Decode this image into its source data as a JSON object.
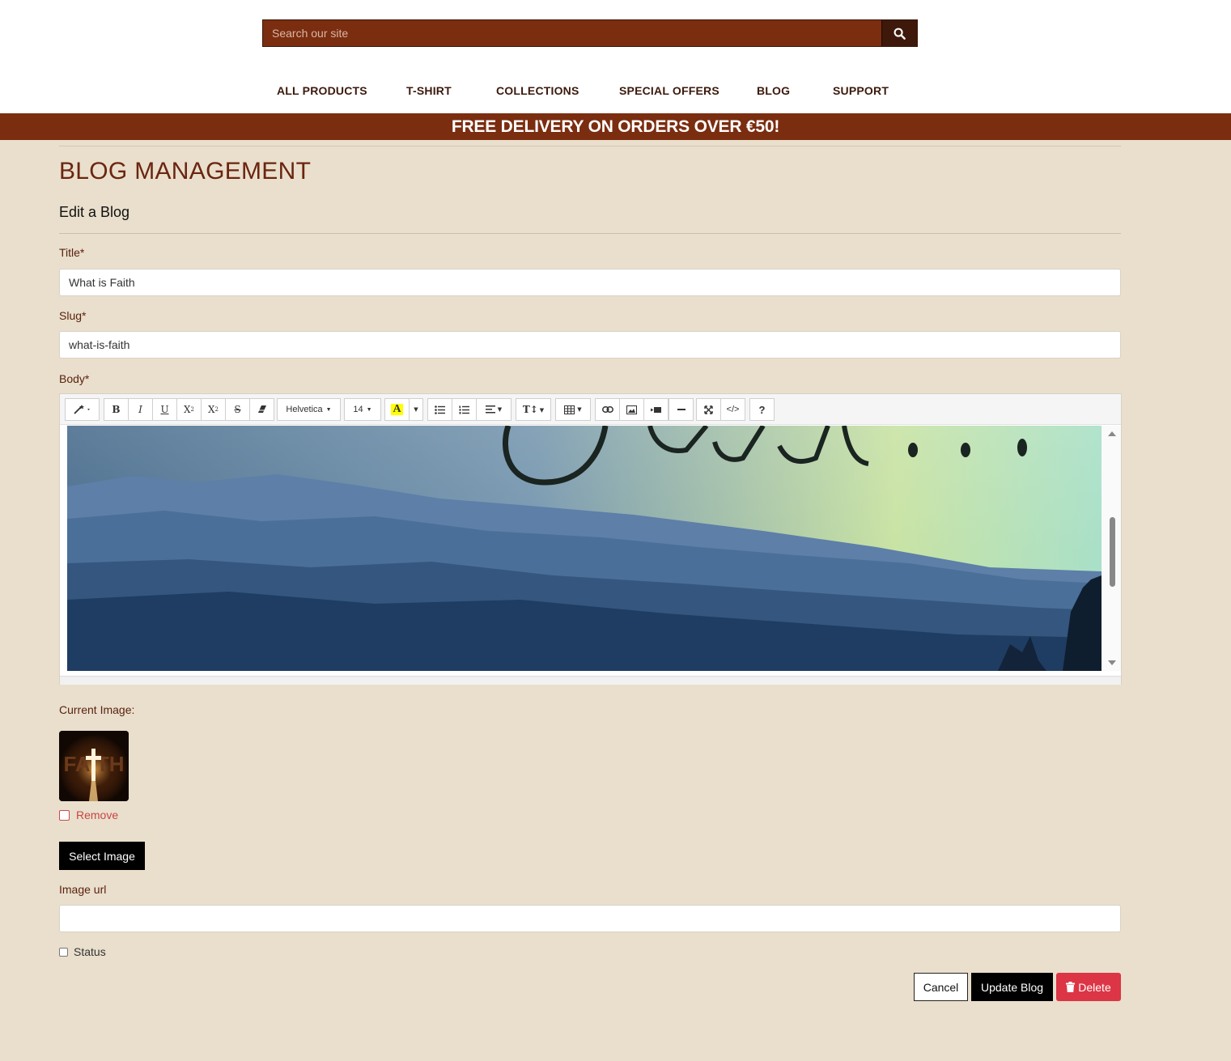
{
  "search": {
    "placeholder": "Search our site"
  },
  "nav": {
    "items": [
      {
        "label": "ALL PRODUCTS"
      },
      {
        "label": "T-SHIRT"
      },
      {
        "label": "COLLECTIONS"
      },
      {
        "label": "SPECIAL OFFERS"
      },
      {
        "label": "BLOG"
      },
      {
        "label": "SUPPORT"
      }
    ]
  },
  "banner": {
    "text": "FREE DELIVERY ON ORDERS OVER €50!"
  },
  "page": {
    "title": "BLOG MANAGEMENT",
    "subtitle": "Edit a Blog"
  },
  "form": {
    "title_label": "Title*",
    "title_value": "What is Faith",
    "slug_label": "Slug*",
    "slug_value": "what-is-faith",
    "body_label": "Body*",
    "current_image_label": "Current Image:",
    "thumbnail_text": "FAITH",
    "remove_label": "Remove",
    "select_image_label": "Select Image",
    "image_url_label": "Image url",
    "image_url_value": "",
    "status_label": "Status"
  },
  "editor": {
    "font_family": "Helvetica",
    "font_size": "14",
    "help_label": "?"
  },
  "actions": {
    "cancel": "Cancel",
    "update": "Update Blog",
    "delete": "Delete"
  },
  "colors": {
    "brand": "#7b2d10",
    "brand_dark": "#3e180b",
    "page_bg": "#e9dfcc",
    "title": "#6a2510",
    "danger": "#dc3545"
  }
}
